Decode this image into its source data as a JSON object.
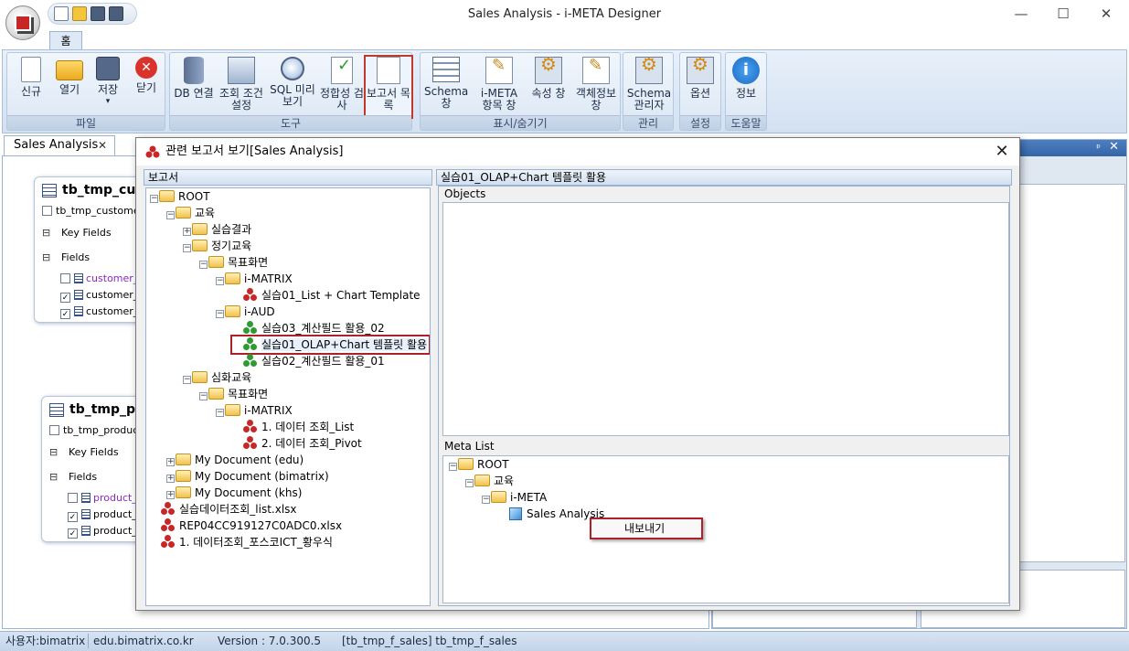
{
  "window": {
    "title": "Sales Analysis - i-META Designer",
    "minimize": "—",
    "maximize": "☐",
    "close": "✕"
  },
  "ribbon": {
    "tab": "홈",
    "groups": [
      {
        "label": "파일",
        "buttons": [
          {
            "label": "신규"
          },
          {
            "label": "열기"
          },
          {
            "label": "저장"
          },
          {
            "label": "닫기"
          }
        ]
      },
      {
        "label": "도구",
        "buttons": [
          {
            "label": "DB 연결"
          },
          {
            "label": "조회 조건 설정"
          },
          {
            "label": "SQL 미리보기"
          },
          {
            "label": "정합성 검사"
          },
          {
            "label": "보고서 목록"
          }
        ]
      },
      {
        "label": "표시/숨기기",
        "buttons": [
          {
            "label": "Schema 창"
          },
          {
            "label": "i-META 항목 창"
          },
          {
            "label": "속성 창"
          },
          {
            "label": "객체정보 창"
          }
        ]
      },
      {
        "label": "관리",
        "buttons": [
          {
            "label": "Schema 관리자"
          }
        ]
      },
      {
        "label": "설정",
        "buttons": [
          {
            "label": "옵션"
          }
        ]
      },
      {
        "label": "도움말",
        "buttons": [
          {
            "label": "정보"
          }
        ]
      }
    ],
    "save_arrow": "▾"
  },
  "document": {
    "tab_label": "Sales Analysis",
    "tab_close": "✕",
    "tables": [
      {
        "title": "tb_tmp_cus",
        "subtitle": "tb_tmp_custome",
        "key_fields": "Key Fields",
        "fields": "Fields",
        "rows": [
          {
            "name": "customer_i",
            "checked": false
          },
          {
            "name": "customer_c",
            "checked": true
          },
          {
            "name": "customer_r",
            "checked": true
          }
        ]
      },
      {
        "title": "tb_tmp_pr",
        "subtitle": "tb_tmp_produc",
        "key_fields": "Key Fields",
        "fields": "Fields",
        "rows": [
          {
            "name": "product_i",
            "checked": false
          },
          {
            "name": "product_c",
            "checked": true
          },
          {
            "name": "product_r",
            "checked": true
          }
        ]
      }
    ]
  },
  "dock": {
    "pin": "ᵖ",
    "close": "✕"
  },
  "dialog": {
    "title": "관련 보고서 보기[Sales Analysis]",
    "close": "✕",
    "left_header": "보고서",
    "right_header": "실습01_OLAP+Chart 템플릿 활용",
    "objects_label": "Objects",
    "meta_list_label": "Meta List",
    "tree": [
      {
        "label": "ROOT",
        "type": "folder",
        "expander": "−"
      },
      {
        "label": "교육",
        "type": "folder",
        "expander": "−"
      },
      {
        "label": "실습결과",
        "type": "folder",
        "expander": "+"
      },
      {
        "label": "정기교육",
        "type": "folder",
        "expander": "−"
      },
      {
        "label": "목표화면",
        "type": "folder",
        "expander": "−"
      },
      {
        "label": "i-MATRIX",
        "type": "folder",
        "expander": "−"
      },
      {
        "label": "실습01_List + Chart Template",
        "type": "report-red",
        "expander": ""
      },
      {
        "label": "i-AUD",
        "type": "folder",
        "expander": "−"
      },
      {
        "label": "실습03_계산필드 활용_02",
        "type": "report-green",
        "expander": ""
      },
      {
        "label": "실습01_OLAP+Chart 템플릿 활용",
        "type": "report-green",
        "expander": "",
        "selected": true
      },
      {
        "label": "실습02_계산필드 활용_01",
        "type": "report-green",
        "expander": ""
      },
      {
        "label": "심화교육",
        "type": "folder",
        "expander": "−"
      },
      {
        "label": "목표화면",
        "type": "folder",
        "expander": "−"
      },
      {
        "label": "i-MATRIX",
        "type": "folder",
        "expander": "−"
      },
      {
        "label": "1. 데이터 조회_List",
        "type": "report-red",
        "expander": ""
      },
      {
        "label": "2. 데이터 조회_Pivot",
        "type": "report-red",
        "expander": ""
      },
      {
        "label": "My Document (edu)",
        "type": "folder",
        "expander": "+"
      },
      {
        "label": "My Document (bimatrix)",
        "type": "folder",
        "expander": "+"
      },
      {
        "label": "My Document (khs)",
        "type": "folder",
        "expander": "+"
      },
      {
        "label": "실습데이터조회_list.xlsx",
        "type": "report-red",
        "expander": ""
      },
      {
        "label": "REP04CC919127C0ADC0.xlsx",
        "type": "report-red",
        "expander": ""
      },
      {
        "label": "1. 데이터조회_포스코ICT_황우식",
        "type": "report-red",
        "expander": ""
      }
    ],
    "meta_tree": [
      {
        "label": "ROOT",
        "type": "folder",
        "expander": "−"
      },
      {
        "label": "교육",
        "type": "folder",
        "expander": "−"
      },
      {
        "label": "i-META",
        "type": "folder",
        "expander": "−"
      },
      {
        "label": "Sales Analysis",
        "type": "cube",
        "expander": ""
      }
    ],
    "context_menu": "내보내기"
  },
  "status": {
    "user": "사용자:bimatrix",
    "email": "edu.bimatrix.co.kr",
    "version": "Version : 7.0.300.5",
    "table": "[tb_tmp_f_sales] tb_tmp_f_sales"
  }
}
